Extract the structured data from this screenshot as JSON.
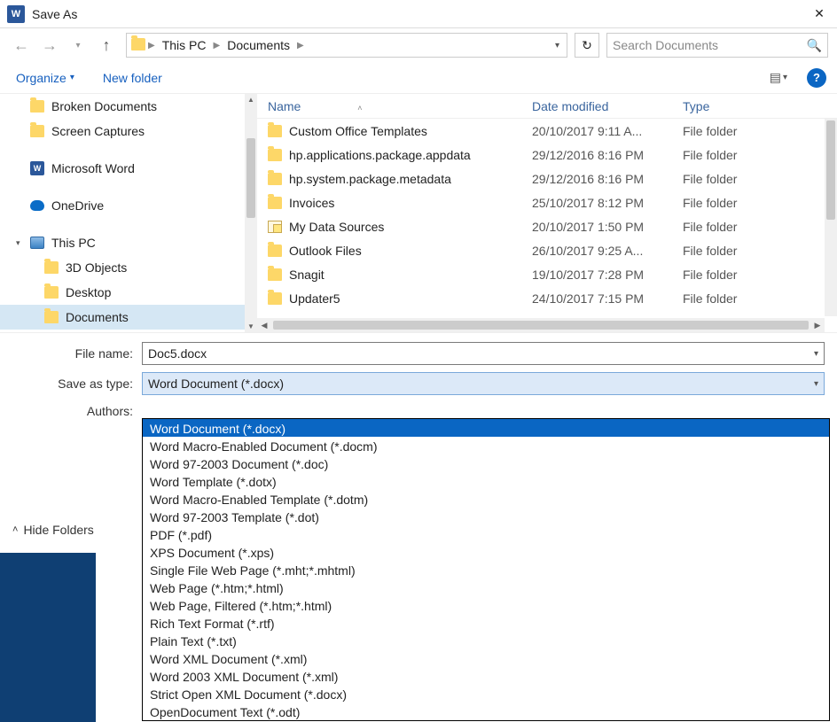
{
  "title": "Save As",
  "breadcrumb": {
    "root": "This PC",
    "folder": "Documents"
  },
  "search_placeholder": "Search Documents",
  "toolbar": {
    "organize": "Organize",
    "newfolder": "New folder"
  },
  "sidebar": {
    "items": [
      {
        "label": "Broken Documents",
        "icon": "folder"
      },
      {
        "label": "Screen Captures",
        "icon": "folder"
      },
      {
        "label": "Microsoft Word",
        "icon": "word"
      },
      {
        "label": "OneDrive",
        "icon": "onedrive"
      },
      {
        "label": "This PC",
        "icon": "thispc",
        "expanded": true
      },
      {
        "label": "3D Objects",
        "icon": "folder",
        "indent": true
      },
      {
        "label": "Desktop",
        "icon": "folder",
        "indent": true
      },
      {
        "label": "Documents",
        "icon": "folder",
        "indent": true,
        "selected": true
      }
    ]
  },
  "columns": {
    "name": "Name",
    "date": "Date modified",
    "type": "Type"
  },
  "files": [
    {
      "name": "Custom Office Templates",
      "date": "20/10/2017 9:11 A...",
      "type": "File folder",
      "icon": "folder"
    },
    {
      "name": "hp.applications.package.appdata",
      "date": "29/12/2016 8:16 PM",
      "type": "File folder",
      "icon": "folder"
    },
    {
      "name": "hp.system.package.metadata",
      "date": "29/12/2016 8:16 PM",
      "type": "File folder",
      "icon": "folder"
    },
    {
      "name": "Invoices",
      "date": "25/10/2017 8:12 PM",
      "type": "File folder",
      "icon": "folder"
    },
    {
      "name": "My Data Sources",
      "date": "20/10/2017 1:50 PM",
      "type": "File folder",
      "icon": "datasource"
    },
    {
      "name": "Outlook Files",
      "date": "26/10/2017 9:25 A...",
      "type": "File folder",
      "icon": "folder"
    },
    {
      "name": "Snagit",
      "date": "19/10/2017 7:28 PM",
      "type": "File folder",
      "icon": "folder"
    },
    {
      "name": "Updater5",
      "date": "24/10/2017 7:15 PM",
      "type": "File folder",
      "icon": "folder"
    }
  ],
  "form": {
    "filename_label": "File name:",
    "filename_value": "Doc5.docx",
    "saveastype_label": "Save as type:",
    "saveastype_value": "Word Document (*.docx)",
    "authors_label": "Authors:"
  },
  "type_options": [
    "Word Document (*.docx)",
    "Word Macro-Enabled Document (*.docm)",
    "Word 97-2003 Document (*.doc)",
    "Word Template (*.dotx)",
    "Word Macro-Enabled Template (*.dotm)",
    "Word 97-2003 Template (*.dot)",
    "PDF (*.pdf)",
    "XPS Document (*.xps)",
    "Single File Web Page (*.mht;*.mhtml)",
    "Web Page (*.htm;*.html)",
    "Web Page, Filtered (*.htm;*.html)",
    "Rich Text Format (*.rtf)",
    "Plain Text (*.txt)",
    "Word XML Document (*.xml)",
    "Word 2003 XML Document (*.xml)",
    "Strict Open XML Document (*.docx)",
    "OpenDocument Text (*.odt)"
  ],
  "hide_folders": "Hide Folders"
}
